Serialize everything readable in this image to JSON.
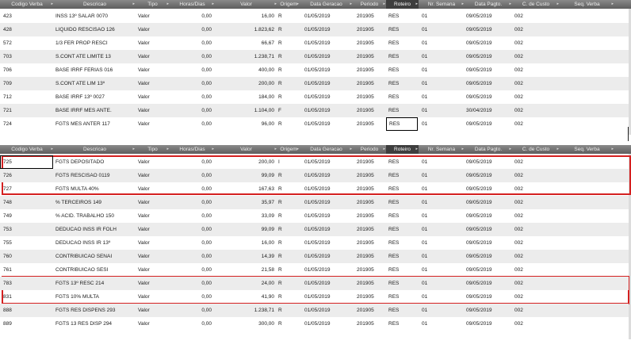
{
  "columns": [
    {
      "key": "code",
      "label": "Codigo Verba"
    },
    {
      "key": "desc",
      "label": "Descricao"
    },
    {
      "key": "tipo",
      "label": "Tipo"
    },
    {
      "key": "horas",
      "label": "Horas/Dias"
    },
    {
      "key": "valor",
      "label": "Valor"
    },
    {
      "key": "origem",
      "label": "Origem"
    },
    {
      "key": "geracao",
      "label": "Data Geracao"
    },
    {
      "key": "periodo",
      "label": "Periodo"
    },
    {
      "key": "roteiro",
      "label": "Roteiro"
    },
    {
      "key": "semana",
      "label": "Nr. Semana"
    },
    {
      "key": "pagto",
      "label": "Data Pagto."
    },
    {
      "key": "custo",
      "label": "C. de Custo"
    },
    {
      "key": "seq",
      "label": "Seq. Verba"
    }
  ],
  "grid_top": {
    "rows": [
      {
        "code": "423",
        "desc": "INSS 13º SALAR 0070",
        "tipo": "Valor",
        "horas": "0,00",
        "valor": "16,00",
        "origem": "R",
        "geracao": "01/05/2019",
        "periodo": "201905",
        "roteiro": "RES",
        "semana": "01",
        "pagto": "09/05/2019",
        "custo": "002",
        "seq": ""
      },
      {
        "code": "428",
        "desc": "LIQUIDO RESCISAO 126",
        "tipo": "Valor",
        "horas": "0,00",
        "valor": "1.823,62",
        "origem": "R",
        "geracao": "01/05/2019",
        "periodo": "201905",
        "roteiro": "RES",
        "semana": "01",
        "pagto": "09/05/2019",
        "custo": "002",
        "seq": ""
      },
      {
        "code": "572",
        "desc": "1/3 FER PROP RESCI",
        "tipo": "Valor",
        "horas": "0,00",
        "valor": "66,67",
        "origem": "R",
        "geracao": "01/05/2019",
        "periodo": "201905",
        "roteiro": "RES",
        "semana": "01",
        "pagto": "09/05/2019",
        "custo": "002",
        "seq": ""
      },
      {
        "code": "703",
        "desc": "S.CONT ATE LIMITE 13",
        "tipo": "Valor",
        "horas": "0,00",
        "valor": "1.238,71",
        "origem": "R",
        "geracao": "01/05/2019",
        "periodo": "201905",
        "roteiro": "RES",
        "semana": "01",
        "pagto": "09/05/2019",
        "custo": "002",
        "seq": ""
      },
      {
        "code": "706",
        "desc": "BASE IRRF FERIAS 016",
        "tipo": "Valor",
        "horas": "0,00",
        "valor": "400,00",
        "origem": "R",
        "geracao": "01/05/2019",
        "periodo": "201905",
        "roteiro": "RES",
        "semana": "01",
        "pagto": "09/05/2019",
        "custo": "002",
        "seq": ""
      },
      {
        "code": "709",
        "desc": "S.CONT ATE LIM 13º",
        "tipo": "Valor",
        "horas": "0,00",
        "valor": "200,00",
        "origem": "R",
        "geracao": "01/05/2019",
        "periodo": "201905",
        "roteiro": "RES",
        "semana": "01",
        "pagto": "09/05/2019",
        "custo": "002",
        "seq": ""
      },
      {
        "code": "712",
        "desc": "BASE IRRF 13º 0027",
        "tipo": "Valor",
        "horas": "0,00",
        "valor": "184,00",
        "origem": "R",
        "geracao": "01/05/2019",
        "periodo": "201905",
        "roteiro": "RES",
        "semana": "01",
        "pagto": "09/05/2019",
        "custo": "002",
        "seq": ""
      },
      {
        "code": "721",
        "desc": "BASE IRRF MES ANTE.",
        "tipo": "Valor",
        "horas": "0,00",
        "valor": "1.104,00",
        "origem": "F",
        "geracao": "01/05/2019",
        "periodo": "201905",
        "roteiro": "RES",
        "semana": "01",
        "pagto": "30/04/2019",
        "custo": "002",
        "seq": ""
      },
      {
        "code": "724",
        "desc": "FGTS MES ANTER 117",
        "tipo": "Valor",
        "horas": "0,00",
        "valor": "96,00",
        "origem": "R",
        "geracao": "01/05/2019",
        "periodo": "201905",
        "roteiro": "RES",
        "semana": "01",
        "pagto": "09/05/2019",
        "custo": "002",
        "seq": ""
      }
    ]
  },
  "grid_bottom": {
    "rows": [
      {
        "code": "725",
        "desc": "FGTS DEPOSITADO",
        "tipo": "Valor",
        "horas": "0,00",
        "valor": "200,00",
        "origem": "I",
        "geracao": "01/05/2019",
        "periodo": "201905",
        "roteiro": "RES",
        "semana": "01",
        "pagto": "09/05/2019",
        "custo": "002",
        "seq": ""
      },
      {
        "code": "726",
        "desc": "FGTS RESCISAO 0119",
        "tipo": "Valor",
        "horas": "0,00",
        "valor": "99,09",
        "origem": "R",
        "geracao": "01/05/2019",
        "periodo": "201905",
        "roteiro": "RES",
        "semana": "01",
        "pagto": "09/05/2019",
        "custo": "002",
        "seq": ""
      },
      {
        "code": "727",
        "desc": "FGTS MULTA 40%",
        "tipo": "Valor",
        "horas": "0,00",
        "valor": "167,63",
        "origem": "R",
        "geracao": "01/05/2019",
        "periodo": "201905",
        "roteiro": "RES",
        "semana": "01",
        "pagto": "09/05/2019",
        "custo": "002",
        "seq": ""
      },
      {
        "code": "748",
        "desc": "% TERCEIROS 149",
        "tipo": "Valor",
        "horas": "0,00",
        "valor": "35,97",
        "origem": "R",
        "geracao": "01/05/2019",
        "periodo": "201905",
        "roteiro": "RES",
        "semana": "01",
        "pagto": "09/05/2019",
        "custo": "002",
        "seq": ""
      },
      {
        "code": "749",
        "desc": "% ACID. TRABALHO 150",
        "tipo": "Valor",
        "horas": "0,00",
        "valor": "33,09",
        "origem": "R",
        "geracao": "01/05/2019",
        "periodo": "201905",
        "roteiro": "RES",
        "semana": "01",
        "pagto": "09/05/2019",
        "custo": "002",
        "seq": ""
      },
      {
        "code": "753",
        "desc": "DEDUCAO INSS IR FOLH",
        "tipo": "Valor",
        "horas": "0,00",
        "valor": "99,09",
        "origem": "R",
        "geracao": "01/05/2019",
        "periodo": "201905",
        "roteiro": "RES",
        "semana": "01",
        "pagto": "09/05/2019",
        "custo": "002",
        "seq": ""
      },
      {
        "code": "755",
        "desc": "DEDUCAO INSS IR 13º",
        "tipo": "Valor",
        "horas": "0,00",
        "valor": "16,00",
        "origem": "R",
        "geracao": "01/05/2019",
        "periodo": "201905",
        "roteiro": "RES",
        "semana": "01",
        "pagto": "09/05/2019",
        "custo": "002",
        "seq": ""
      },
      {
        "code": "760",
        "desc": "CONTRIBUICAO SENAI",
        "tipo": "Valor",
        "horas": "0,00",
        "valor": "14,39",
        "origem": "R",
        "geracao": "01/05/2019",
        "periodo": "201905",
        "roteiro": "RES",
        "semana": "01",
        "pagto": "09/05/2019",
        "custo": "002",
        "seq": ""
      },
      {
        "code": "761",
        "desc": "CONTRIBUICAO SESI",
        "tipo": "Valor",
        "horas": "0,00",
        "valor": "21,58",
        "origem": "R",
        "geracao": "01/05/2019",
        "periodo": "201905",
        "roteiro": "RES",
        "semana": "01",
        "pagto": "09/05/2019",
        "custo": "002",
        "seq": ""
      },
      {
        "code": "783",
        "desc": "FGTS 13º RESC 214",
        "tipo": "Valor",
        "horas": "0,00",
        "valor": "24,00",
        "origem": "R",
        "geracao": "01/05/2019",
        "periodo": "201905",
        "roteiro": "RES",
        "semana": "01",
        "pagto": "09/05/2019",
        "custo": "002",
        "seq": ""
      },
      {
        "code": "831",
        "desc": "FGTS 10% MULTA",
        "tipo": "Valor",
        "horas": "0,00",
        "valor": "41,90",
        "origem": "R",
        "geracao": "01/05/2019",
        "periodo": "201905",
        "roteiro": "RES",
        "semana": "01",
        "pagto": "09/05/2019",
        "custo": "002",
        "seq": ""
      },
      {
        "code": "888",
        "desc": "FGTS RES DISPENS 293",
        "tipo": "Valor",
        "horas": "0,00",
        "valor": "1.238,71",
        "origem": "R",
        "geracao": "01/05/2019",
        "periodo": "201905",
        "roteiro": "RES",
        "semana": "01",
        "pagto": "09/05/2019",
        "custo": "002",
        "seq": ""
      },
      {
        "code": "889",
        "desc": "FGTS 13 RES DISP 294",
        "tipo": "Valor",
        "horas": "0,00",
        "valor": "300,00",
        "origem": "R",
        "geracao": "01/05/2019",
        "periodo": "201905",
        "roteiro": "RES",
        "semana": "01",
        "pagto": "09/05/2019",
        "custo": "002",
        "seq": ""
      }
    ]
  },
  "style": {
    "highlight_color": "#d42020",
    "header_color": "#6e6e6e",
    "alt_row_color": "#ececec"
  }
}
